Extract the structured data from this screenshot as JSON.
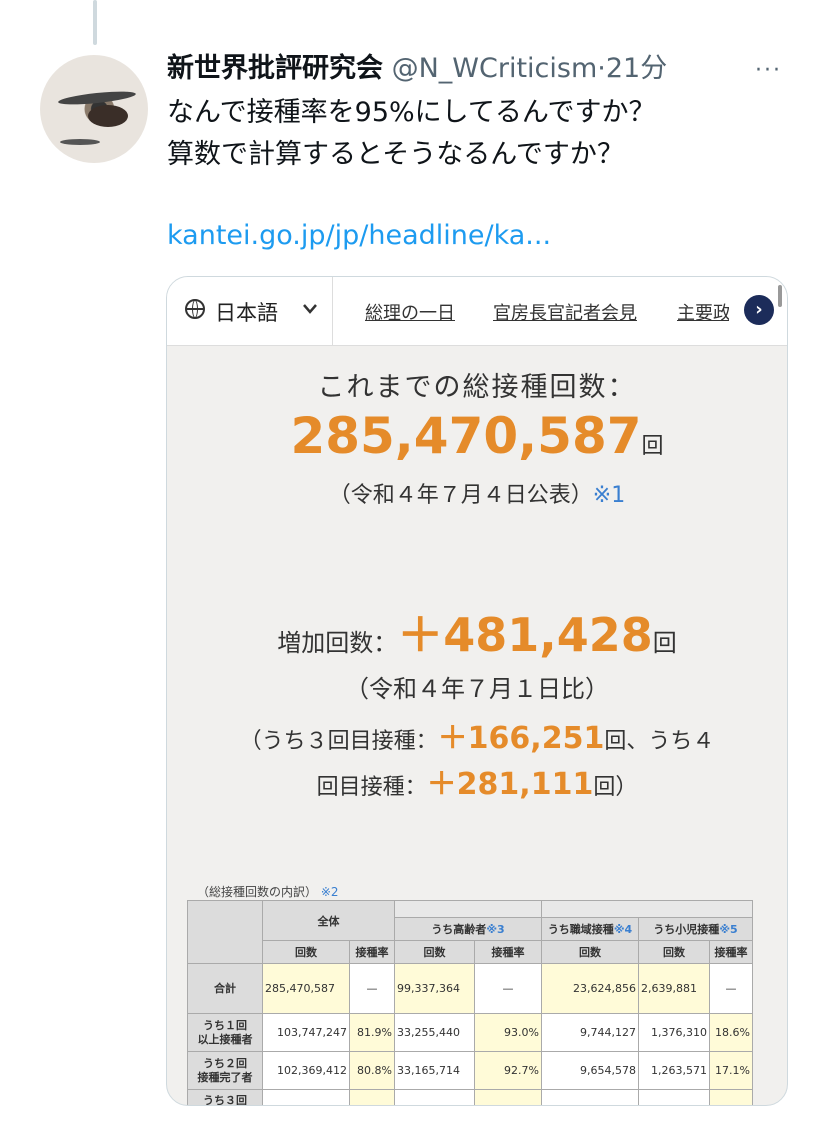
{
  "tweet": {
    "display_name": "新世界批評研究会",
    "handle": "@N_WCriticism",
    "time": "·21分",
    "more": "···",
    "lines": [
      "なんで接種率を95%にしてるんですか？",
      "算数で計算するとそうなるんですか？"
    ],
    "link": "kantei.go.jp/jp/headline/ka..."
  },
  "card": {
    "nav": {
      "language": "日本語",
      "items": [
        "総理の一日",
        "官房長官記者会見",
        "主要政"
      ],
      "next": "›"
    },
    "total_label": "これまでの総接種回数：",
    "total_value": "285,470,587",
    "unit": "回",
    "total_date": "（令和４年７月４日公表）",
    "total_note": "※1",
    "increase_label": "増加回数：",
    "increase_value": "＋481,428",
    "increase_date": "（令和４年７月１日比）",
    "third_prefix": "（うち３回目接種：",
    "third_value": "＋166,251",
    "third_suffix": "回、うち４",
    "fourth_prefix": "回目接種：",
    "fourth_value": "＋281,111",
    "fourth_suffix": "回）",
    "breakdown_title": "（総接種回数の内訳）",
    "breakdown_note": "※2",
    "table": {
      "h_all": "全体",
      "h_elderly": "うち高齢者",
      "h_elderly_note": "※3",
      "h_work": "うち職域接種",
      "h_work_note": "※4",
      "h_child": "うち小児接種",
      "h_child_note": "※5",
      "col_count": "回数",
      "col_rate": "接種率",
      "rows": [
        {
          "label1": "合計",
          "label2": "",
          "all_count": "285,470,587",
          "all_rate": "—",
          "eld_count": "99,337,364",
          "eld_rate": "—",
          "work_count": "23,624,856",
          "child_count": "2,639,881",
          "child_rate": "—"
        },
        {
          "label1": "うち１回",
          "label2": "以上接種者",
          "all_count": "103,747,247",
          "all_rate": "81.9%",
          "eld_count": "33,255,440",
          "eld_rate": "93.0%",
          "work_count": "9,744,127",
          "child_count": "1,376,310",
          "child_rate": "18.6%"
        },
        {
          "label1": "うち２回",
          "label2": "接種完了者",
          "all_count": "102,369,412",
          "all_rate": "80.8%",
          "eld_count": "33,165,714",
          "eld_rate": "92.7%",
          "work_count": "9,654,578",
          "child_count": "1,263,571",
          "child_rate": "17.1%"
        }
      ],
      "partial_row": "うち３回"
    }
  }
}
